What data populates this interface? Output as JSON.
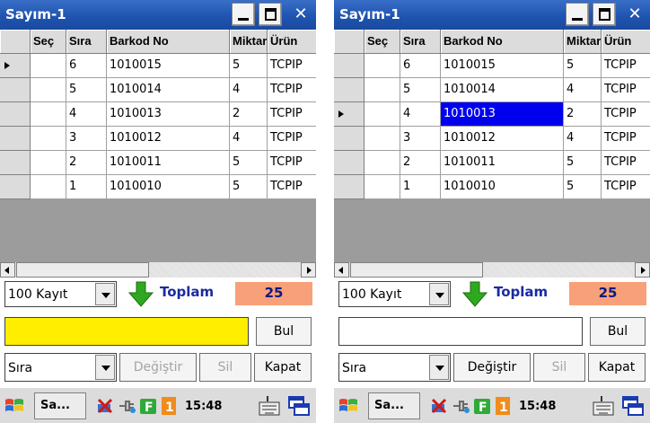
{
  "screens": [
    {
      "title": "Sayım-1",
      "columns": [
        "Seç",
        "Sıra",
        "Barkod No",
        "Miktar",
        "Ürün"
      ],
      "rows": [
        {
          "sec": "",
          "sira": "6",
          "barkod": "1010015",
          "miktar": "5",
          "urun": "TCPIP"
        },
        {
          "sec": "",
          "sira": "5",
          "barkod": "1010014",
          "miktar": "4",
          "urun": "TCPIP"
        },
        {
          "sec": "",
          "sira": "4",
          "barkod": "1010013",
          "miktar": "2",
          "urun": "TCPIP"
        },
        {
          "sec": "",
          "sira": "3",
          "barkod": "1010012",
          "miktar": "4",
          "urun": "TCPIP"
        },
        {
          "sec": "",
          "sira": "2",
          "barkod": "1010011",
          "miktar": "5",
          "urun": "TCPIP"
        },
        {
          "sec": "",
          "sira": "1",
          "barkod": "1010010",
          "miktar": "5",
          "urun": "TCPIP"
        }
      ],
      "current_row_index": 0,
      "selected_cell": null,
      "record_limit": "100 Kayıt",
      "toplam_label": "Toplam",
      "toplam_value": "25",
      "search_value": "",
      "search_field_color": "#ffee00",
      "bul_label": "Bul",
      "sort_field": "Sıra",
      "degistir_label": "Değiştir",
      "degistir_enabled": false,
      "sil_label": "Sil",
      "sil_enabled": false,
      "kapat_label": "Kapat",
      "taskbar_app": "Sa...",
      "clock": "15:48"
    },
    {
      "title": "Sayım-1",
      "columns": [
        "Seç",
        "Sıra",
        "Barkod No",
        "Miktar",
        "Ürün"
      ],
      "rows": [
        {
          "sec": "",
          "sira": "6",
          "barkod": "1010015",
          "miktar": "5",
          "urun": "TCPIP"
        },
        {
          "sec": "",
          "sira": "5",
          "barkod": "1010014",
          "miktar": "4",
          "urun": "TCPIP"
        },
        {
          "sec": "",
          "sira": "4",
          "barkod": "1010013",
          "miktar": "2",
          "urun": "TCPIP"
        },
        {
          "sec": "",
          "sira": "3",
          "barkod": "1010012",
          "miktar": "4",
          "urun": "TCPIP"
        },
        {
          "sec": "",
          "sira": "2",
          "barkod": "1010011",
          "miktar": "5",
          "urun": "TCPIP"
        },
        {
          "sec": "",
          "sira": "1",
          "barkod": "1010010",
          "miktar": "5",
          "urun": "TCPIP"
        }
      ],
      "current_row_index": 2,
      "selected_cell": "barkod",
      "record_limit": "100 Kayıt",
      "toplam_label": "Toplam",
      "toplam_value": "25",
      "search_value": "",
      "search_field_color": "#ffffff",
      "bul_label": "Bul",
      "sort_field": "Sıra",
      "degistir_label": "Değiştir",
      "degistir_enabled": true,
      "sil_label": "Sil",
      "sil_enabled": false,
      "kapat_label": "Kapat",
      "taskbar_app": "Sa...",
      "clock": "15:48"
    }
  ],
  "icons": [
    "windows-start-icon",
    "tools-icon",
    "network-plug-icon",
    "f-icon",
    "one-icon",
    "keyboard-icon",
    "windows-switch-icon",
    "green-down-arrow-icon"
  ],
  "colors": {
    "titlebar": "#1f54b0",
    "selection": "#0000ee",
    "toplam_bg": "#f8a07a",
    "toplam_text": "#0a1a80",
    "grid_empty": "#9c9c9c"
  }
}
